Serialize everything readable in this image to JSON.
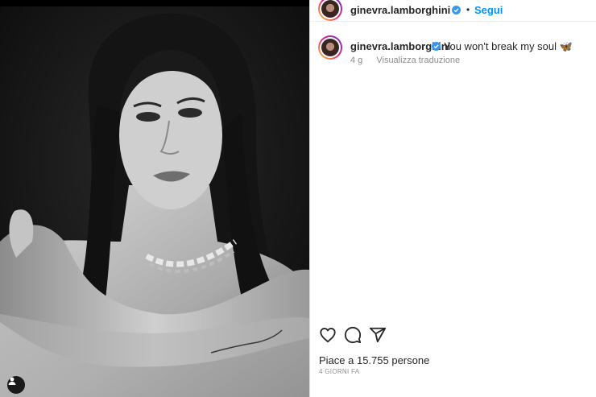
{
  "post": {
    "username": "ginevra.lamborghini",
    "separator": "•",
    "follow_label": "Segui",
    "caption": "You won't break my soul",
    "caption_emoji": "🦋",
    "age": "4 g",
    "translate_label": "Visualizza traduzione",
    "likes_text": "Piace a 15.755 persone",
    "date_text": "4 GIORNI FA"
  },
  "icons": {
    "verified": "verified-badge-icon",
    "like": "heart-icon",
    "comment": "comment-icon",
    "share": "paper-plane-icon",
    "tag": "user-tag-icon"
  },
  "colors": {
    "link_blue": "#0095f6",
    "verified_blue": "#3897f0",
    "text_primary": "#262626",
    "text_secondary": "#8e8e8e"
  }
}
